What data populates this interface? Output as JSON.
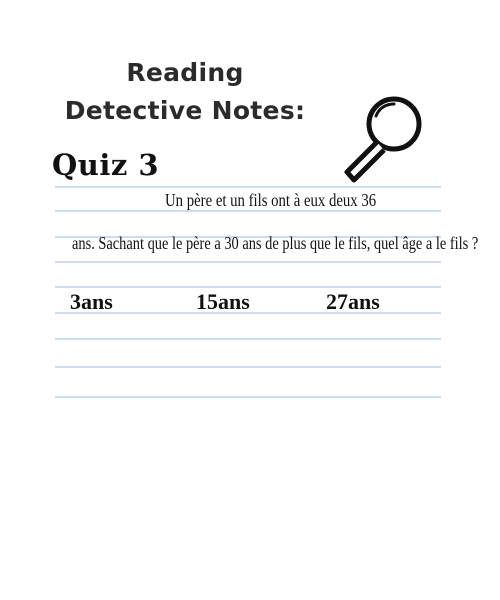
{
  "header": {
    "title_line_1": "Reading",
    "title_line_2": "Detective Notes:",
    "icon": "magnifying-glass-icon"
  },
  "quiz": {
    "title": "Quiz 3",
    "question_line_1": "Un père et un fils ont à eux deux 36",
    "question_line_2": "ans. Sachant que le père a 30 ans de plus que le fils, quel âge a le fils ?",
    "answers": [
      "3ans",
      "15ans",
      "27ans"
    ]
  },
  "colors": {
    "ruled_line": "#cfdcef",
    "text": "#111111",
    "background": "#ffffff"
  }
}
